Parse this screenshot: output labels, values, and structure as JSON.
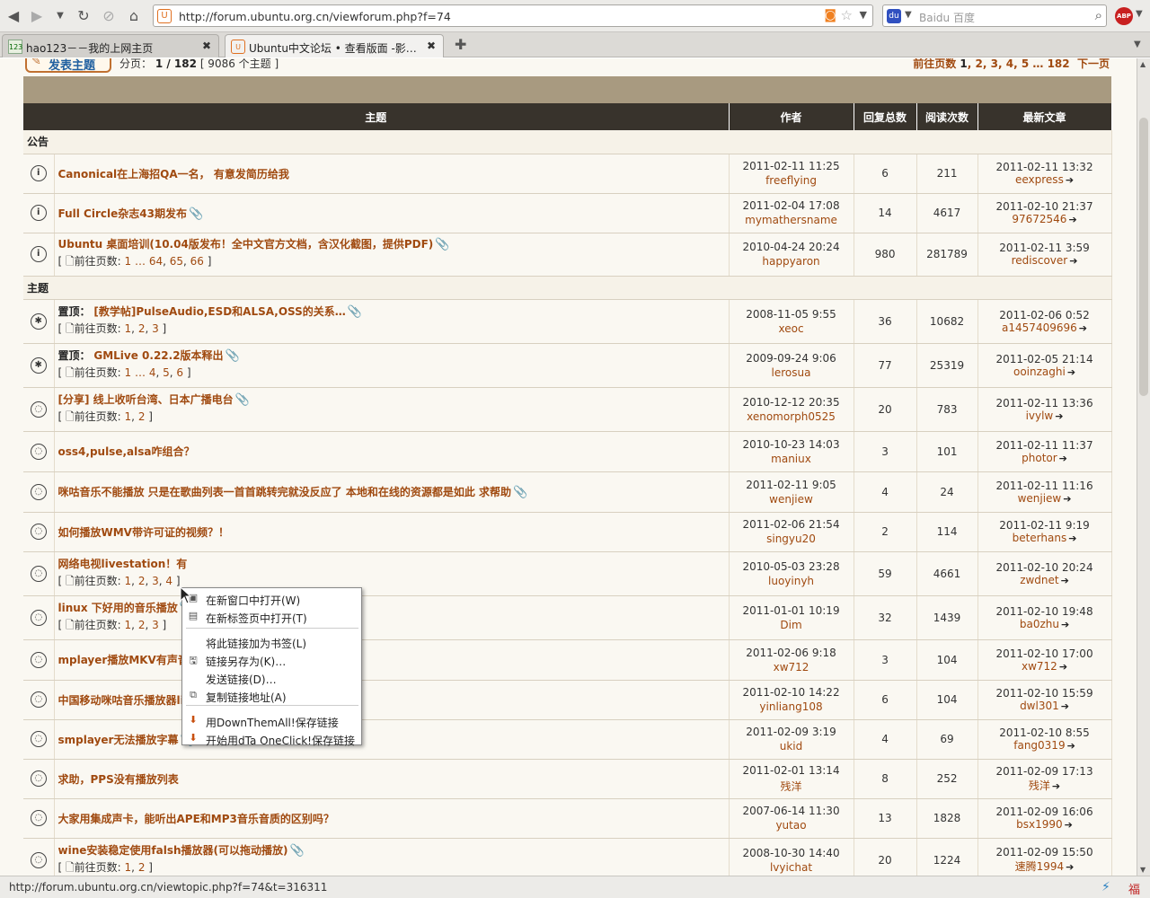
{
  "browser": {
    "url": "http://forum.ubuntu.org.cn/viewforum.php?f=74",
    "search_placeholder": "Baidu 百度",
    "abp_label": "ABP",
    "tabs": [
      {
        "title": "hao123－－我的上网主页",
        "icon": "hao123-icon"
      },
      {
        "title": "Ubuntu中文论坛 • 查看版面 -影…",
        "icon": "ubuntu-favicon"
      }
    ],
    "status_url": "http://forum.ubuntu.org.cn/viewtopic.php?f=74&t=316311"
  },
  "forum": {
    "new_topic": "发表主题",
    "page_label": "分页：",
    "page_value": "1 / 182",
    "topic_count": "[ 9086 个主题 ]",
    "pagenav": {
      "label": "前往页数",
      "current": "1",
      "pages": [
        "2",
        "3",
        "4",
        "5"
      ],
      "ellipsis": "…",
      "last": "182",
      "next": "下一页"
    },
    "headers": {
      "topic": "主题",
      "author": "作者",
      "replies": "回复总数",
      "views": "阅读次数",
      "last_post": "最新文章"
    },
    "sections": {
      "announcements": "公告",
      "topics": "主题"
    },
    "goto_label": "前往页数:",
    "sticky_label": "置顶：",
    "announcements": [
      {
        "title": "Canonical在上海招QA一名， 有意发简历给我",
        "clip": false,
        "pages": [],
        "date": "2011-02-11 11:25",
        "author": "freeflying",
        "replies": "6",
        "views": "211",
        "last_date": "2011-02-11 13:32",
        "last_user": "eexpress"
      },
      {
        "title": "Full Circle杂志43期发布",
        "clip": true,
        "pages": [],
        "date": "2011-02-04 17:08",
        "author": "mymathersname",
        "replies": "14",
        "views": "4617",
        "last_date": "2011-02-10 21:37",
        "last_user": "97672546"
      },
      {
        "title": "Ubuntu 桌面培训(10.04版发布！全中文官方文档，含汉化截图，提供PDF)",
        "clip": true,
        "pages": [
          "1",
          "…",
          "64",
          "65",
          "66"
        ],
        "date": "2010-04-24 20:24",
        "author": "happyaron",
        "replies": "980",
        "views": "281789",
        "last_date": "2011-02-11 3:59",
        "last_user": "rediscover"
      }
    ],
    "topics": [
      {
        "sticky": true,
        "title": "[教学帖]PulseAudio,ESD和ALSA,OSS的关系…",
        "clip": true,
        "pages": [
          "1",
          "2",
          "3"
        ],
        "date": "2008-11-05 9:55",
        "author": "xeoc",
        "replies": "36",
        "views": "10682",
        "last_date": "2011-02-06 0:52",
        "last_user": "a1457409696"
      },
      {
        "sticky": true,
        "title": "GMLive 0.22.2版本释出",
        "clip": true,
        "pages": [
          "1",
          "…",
          "4",
          "5",
          "6"
        ],
        "date": "2009-09-24 9:06",
        "author": "lerosua",
        "replies": "77",
        "views": "25319",
        "last_date": "2011-02-05 21:14",
        "last_user": "ooinzaghi"
      },
      {
        "sticky": false,
        "title": "[分享] 线上收听台湾、日本广播电台",
        "clip": true,
        "pages": [
          "1",
          "2"
        ],
        "date": "2010-12-12 20:35",
        "author": "xenomorph0525",
        "replies": "20",
        "views": "783",
        "last_date": "2011-02-11 13:36",
        "last_user": "ivylw"
      },
      {
        "sticky": false,
        "title": "oss4,pulse,alsa咋组合？",
        "clip": false,
        "pages": [],
        "date": "2010-10-23 14:03",
        "author": "maniux",
        "replies": "3",
        "views": "101",
        "last_date": "2011-02-11 11:37",
        "last_user": "photor"
      },
      {
        "sticky": false,
        "title": "咪咕音乐不能播放 只是在歌曲列表一首首跳转完就没反应了 本地和在线的资源都是如此 求帮助",
        "clip": true,
        "pages": [],
        "date": "2011-02-11 9:05",
        "author": "wenjiew",
        "replies": "4",
        "views": "24",
        "last_date": "2011-02-11 11:16",
        "last_user": "wenjiew"
      },
      {
        "sticky": false,
        "title": "如何播放WMV带许可证的视频？！",
        "clip": false,
        "pages": [],
        "date": "2011-02-06 21:54",
        "author": "singyu20",
        "replies": "2",
        "views": "114",
        "last_date": "2011-02-11 9:19",
        "last_user": "beterhans"
      },
      {
        "sticky": false,
        "title": "网络电视livestation！有",
        "clip": false,
        "pages": [
          "1",
          "2",
          "3",
          "4"
        ],
        "date": "2010-05-03 23:28",
        "author": "luoyinyh",
        "replies": "59",
        "views": "4661",
        "last_date": "2011-02-10 20:24",
        "last_user": "zwdnet"
      },
      {
        "sticky": false,
        "title": "linux 下好用的音乐播放",
        "clip": true,
        "pages": [
          "1",
          "2",
          "3"
        ],
        "date": "2011-01-01 10:19",
        "author": "Dim",
        "replies": "32",
        "views": "1439",
        "last_date": "2011-02-10 19:48",
        "last_user": "ba0zhu"
      },
      {
        "sticky": false,
        "title": "mplayer播放MKV有声音",
        "clip": false,
        "pages": [],
        "date": "2011-02-06 9:18",
        "author": "xw712",
        "replies": "3",
        "views": "104",
        "last_date": "2011-02-10 17:00",
        "last_user": "xw712"
      },
      {
        "sticky": false,
        "title": "中国移动咪咕音乐播放器linux版本更新了，有图有真相",
        "clip": true,
        "pages": [],
        "date": "2011-02-10 14:22",
        "author": "yinliang108",
        "replies": "6",
        "views": "104",
        "last_date": "2011-02-10 15:59",
        "last_user": "dwl301"
      },
      {
        "sticky": false,
        "title": "smplayer无法播放字幕",
        "clip": true,
        "pages": [],
        "date": "2011-02-09 3:19",
        "author": "ukid",
        "replies": "4",
        "views": "69",
        "last_date": "2011-02-10 8:55",
        "last_user": "fang0319"
      },
      {
        "sticky": false,
        "title": "求助，PPS没有播放列表",
        "clip": false,
        "pages": [],
        "date": "2011-02-01 13:14",
        "author": "残洋",
        "replies": "8",
        "views": "252",
        "last_date": "2011-02-09 17:13",
        "last_user": "残洋"
      },
      {
        "sticky": false,
        "title": "大家用集成声卡，能听出APE和MP3音乐音质的区别吗？",
        "clip": false,
        "pages": [],
        "date": "2007-06-14 11:30",
        "author": "yutao",
        "replies": "13",
        "views": "1828",
        "last_date": "2011-02-09 16:06",
        "last_user": "bsx1990"
      },
      {
        "sticky": false,
        "title": "wine安装稳定使用falsh播放器(可以拖动播放)",
        "clip": true,
        "pages": [
          "1",
          "2"
        ],
        "date": "2008-10-30 14:40",
        "author": "lvyichat",
        "replies": "20",
        "views": "1224",
        "last_date": "2011-02-09 15:50",
        "last_user": "速腾1994"
      }
    ]
  },
  "context_menu": {
    "items": [
      {
        "label": "在新窗口中打开(W)",
        "icon": "new-window-icon"
      },
      {
        "label": "在新标签页中打开(T)",
        "icon": "new-tab-icon"
      },
      {
        "label": "将此链接加为书签(L)",
        "icon": ""
      },
      {
        "label": "链接另存为(K)…",
        "icon": "save-icon"
      },
      {
        "label": "发送链接(D)…",
        "icon": ""
      },
      {
        "label": "复制链接地址(A)",
        "icon": "copy-icon"
      },
      {
        "label": "用DownThemAll!保存链接",
        "icon": "downthemall-icon"
      },
      {
        "label": "开始用dTa OneClick!保存链接",
        "icon": "dta-icon"
      }
    ]
  }
}
